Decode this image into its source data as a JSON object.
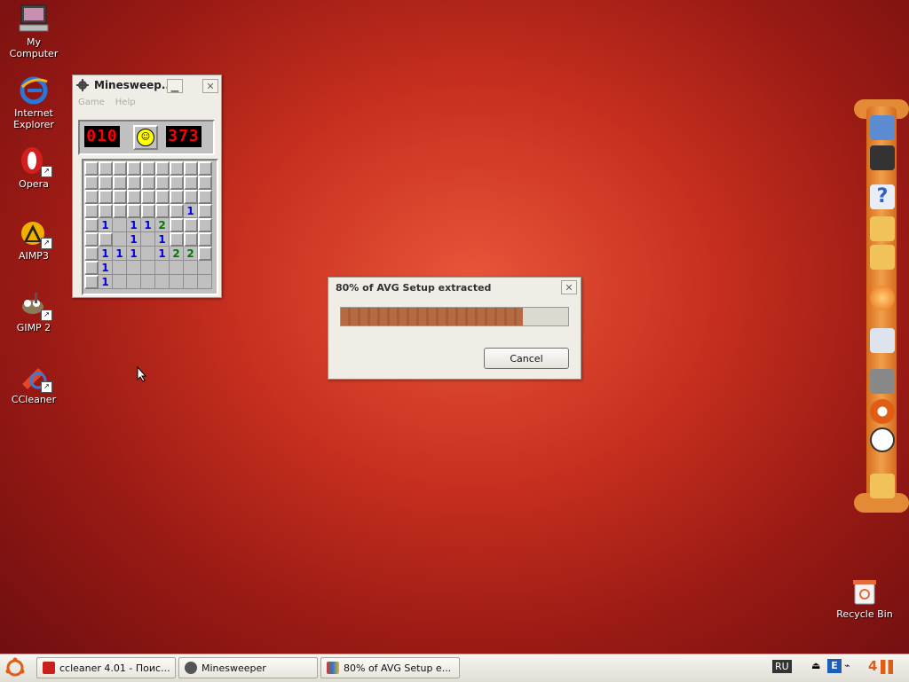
{
  "desktop": {
    "icons": [
      {
        "label": "My Computer"
      },
      {
        "label": "Internet\nExplorer"
      },
      {
        "label": "Opera"
      },
      {
        "label": "AIMP3"
      },
      {
        "label": "GIMP 2"
      },
      {
        "label": "CCleaner"
      }
    ],
    "recycle_label": "Recycle Bin"
  },
  "minesweeper": {
    "title": "Minesweep...",
    "menu": [
      "Game",
      "Help"
    ],
    "mine_counter": "010",
    "timer": "373",
    "grid": [
      [
        "c",
        "c",
        "c",
        "c",
        "c",
        "c",
        "c",
        "c",
        "c"
      ],
      [
        "c",
        "c",
        "c",
        "c",
        "c",
        "c",
        "c",
        "c",
        "c"
      ],
      [
        "c",
        "c",
        "c",
        "c",
        "c",
        "c",
        "c",
        "c",
        "c"
      ],
      [
        "c",
        "c",
        "c",
        "c",
        "c",
        "c",
        "c",
        "1",
        "c"
      ],
      [
        "c",
        "1",
        "o",
        "1",
        "1",
        "2",
        "c",
        "c",
        "c"
      ],
      [
        "c",
        "c",
        "o",
        "1",
        "o",
        "1",
        "c",
        "c",
        "c"
      ],
      [
        "c",
        "1",
        "1",
        "1",
        "o",
        "1",
        "2",
        "2",
        "c"
      ],
      [
        "c",
        "1",
        "o",
        "o",
        "o",
        "o",
        "o",
        "o",
        "o"
      ],
      [
        "c",
        "1",
        "o",
        "o",
        "o",
        "o",
        "o",
        "o",
        "o"
      ]
    ]
  },
  "avg_dialog": {
    "title": "80% of AVG Setup extracted",
    "progress": 0.8,
    "cancel_label": "Cancel"
  },
  "taskbar": {
    "buttons": [
      {
        "label": "ccleaner 4.01 - Поис..."
      },
      {
        "label": "Minesweeper"
      },
      {
        "label": "80% of AVG Setup e..."
      }
    ],
    "lang": "RU",
    "clock_text": "4"
  }
}
